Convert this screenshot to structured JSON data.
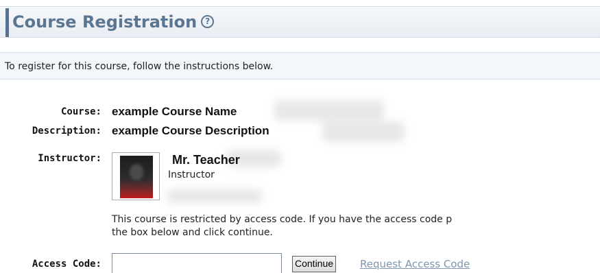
{
  "header": {
    "title": "Course Registration",
    "help_icon": "?"
  },
  "instructions": "To register for this course, follow the instructions below.",
  "course": {
    "label": "Course:",
    "value": "example Course Name"
  },
  "description": {
    "label": "Description:",
    "value": "example Course Description"
  },
  "instructor": {
    "label": "Instructor:",
    "name": "Mr. Teacher",
    "role": "Instructor"
  },
  "restricted_text": {
    "line1": "This course is restricted by access code. If you have the access code p",
    "line2": "the box below and click continue."
  },
  "access_code": {
    "label": "Access Code:",
    "value": "",
    "continue_label": "Continue",
    "request_link": "Request Access Code"
  },
  "colors": {
    "header_title": "#5b7690",
    "header_accent": "#5b718c",
    "link": "#7f95b0"
  }
}
